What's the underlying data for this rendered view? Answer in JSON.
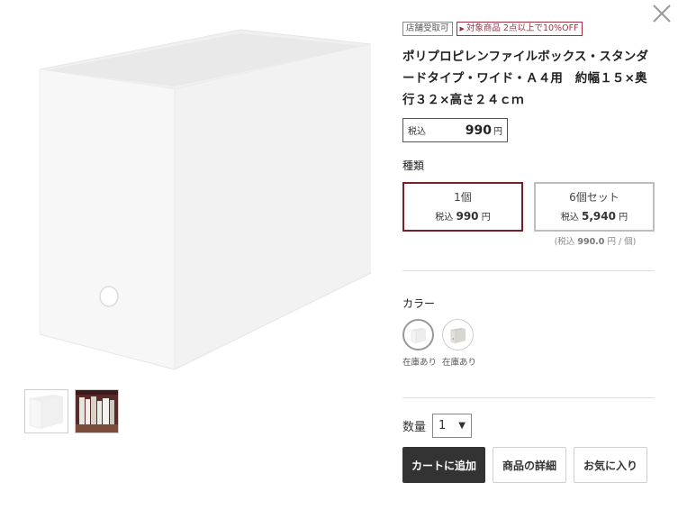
{
  "product": {
    "tags": {
      "pickup": "店舗受取可",
      "sale": "対象商品 2点以上で10%OFF"
    },
    "title": "ポリプロピレンファイルボックス・スタンダードタイプ・ワイド・Ａ４用　約幅１５×奥行３２×高さ２４ｃｍ",
    "price": {
      "tax_label": "税込",
      "amount": "990",
      "currency": "円"
    },
    "type_section": {
      "label": "種類",
      "variants": [
        {
          "name": "1個",
          "tax_label": "税込",
          "price": "990",
          "currency": "円",
          "selected": true
        },
        {
          "name": "6個セット",
          "tax_label": "税込",
          "price": "5,940",
          "currency": "円",
          "selected": false
        }
      ],
      "unit_note": {
        "prefix": "(税込",
        "value": "990.0",
        "suffix": "円 / 個)"
      }
    },
    "color_section": {
      "label": "カラー",
      "swatches": [
        {
          "icon": "white-box-icon",
          "stock": "在庫あり",
          "color": "#f2f2f2",
          "selected": true
        },
        {
          "icon": "gray-box-icon",
          "stock": "在庫あり",
          "color": "#d8d6d0",
          "selected": false
        }
      ]
    },
    "quantity": {
      "label": "数量",
      "value": "1"
    },
    "actions": {
      "cart": "カートに追加",
      "detail": "商品の詳細",
      "favorite": "お気に入り"
    }
  },
  "colors": {
    "accent": "#7a1f2a",
    "sale_tag": "#a03040",
    "cart_button": "#333333"
  }
}
